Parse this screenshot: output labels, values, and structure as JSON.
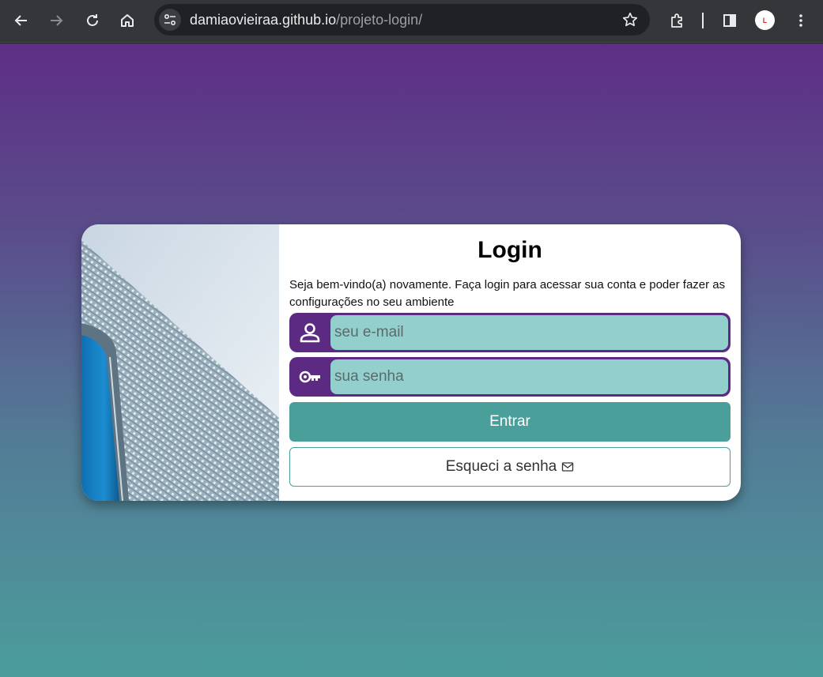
{
  "browser": {
    "url_host": "damiaovieiraa.github.io",
    "url_path": "/projeto-login/",
    "profile_initial": "L",
    "icons": [
      "back-arrow-icon",
      "forward-arrow-icon",
      "reload-icon",
      "home-icon",
      "site-settings-icon",
      "bookmark-star-icon",
      "extensions-icon",
      "side-panel-icon",
      "profile-avatar",
      "more-menu-icon"
    ]
  },
  "page": {
    "title": "Login",
    "intro": "Seja bem-vindo(a) novamente. Faça login para acessar sua conta e poder fazer as configurações no seu ambiente",
    "email": {
      "placeholder": "seu e-mail",
      "value": "",
      "icon": "user-icon"
    },
    "password": {
      "placeholder": "sua senha",
      "value": "",
      "icon": "key-icon"
    },
    "submit_label": "Entrar",
    "forgot_label": "Esqueci a senha",
    "forgot_icon": "envelope-icon"
  },
  "colors": {
    "gradient_top": "#5e2e86",
    "gradient_bottom": "#4b9c9b",
    "field_frame": "#5d2a83",
    "field_fill": "#93cfcd",
    "primary_button": "#4a9f9b"
  }
}
